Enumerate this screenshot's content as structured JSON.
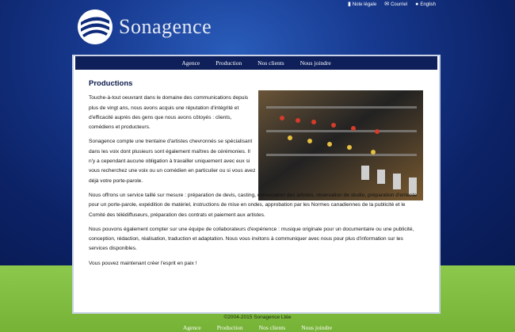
{
  "top_links": [
    {
      "label": "Note légale",
      "icon": "document-icon"
    },
    {
      "label": "Courriel",
      "icon": "envelope-icon"
    },
    {
      "label": "English",
      "icon": "speech-bubble-icon"
    }
  ],
  "logo": {
    "text": "Sonagence"
  },
  "nav": [
    "Agence",
    "Production",
    "Nos clients",
    "Nous joindre"
  ],
  "content": {
    "title": "Productions",
    "paragraphs": [
      "Touche-à-tout oeuvrant dans le domaine des communications depuis plus de vingt ans, nous avons acquis une réputation d'intégrité et d'efficacité auprès des gens que nous avons côtoyés : clients, comédiens et producteurs.",
      "Sonagence compte une trentaine d'artistes chevronnés se spécialisant dans les voix dont plusieurs sont également maîtres de cérémonies. Il n'y a cependant aucune obligation à travailler uniquement avec eux si vous recherchez une voix ou un comédien en particulier ou si vous avez déjà votre porte-parole.",
      "Nous offrons un service taillé sur mesure : préparation de devis, casting, convocation des artistes, réservation de studio, préparation d'entente pour un porte-parole, expédition de matériel, instructions de mise en ondes, approbation par les Normes canadiennes de la publicité et le Comité des télédiffuseurs, préparation des contrats et paiement aux artistes.",
      "Nous pouvons également compter sur une équipe de collaborateurs d'expérience : musique originale pour un documentaire ou une publicité, conception, rédaction, réalisation, traduction et adaptation. Nous vous invitons à communiquer avec nous pour plus d'information sur les services disponibles.",
      "Vous pouvez maintenant créer l'esprit en paix !"
    ]
  },
  "footer": {
    "copyright": "©2004-2015 Sonagence Ltée",
    "nav": [
      "Agence",
      "Production",
      "Nos clients",
      "Nous joindre"
    ]
  },
  "colors": {
    "nav_bg": "#0e1f5a",
    "blue_bg": "#17398f",
    "green_bg": "#7fbf3f",
    "title": "#0b1a4a"
  }
}
